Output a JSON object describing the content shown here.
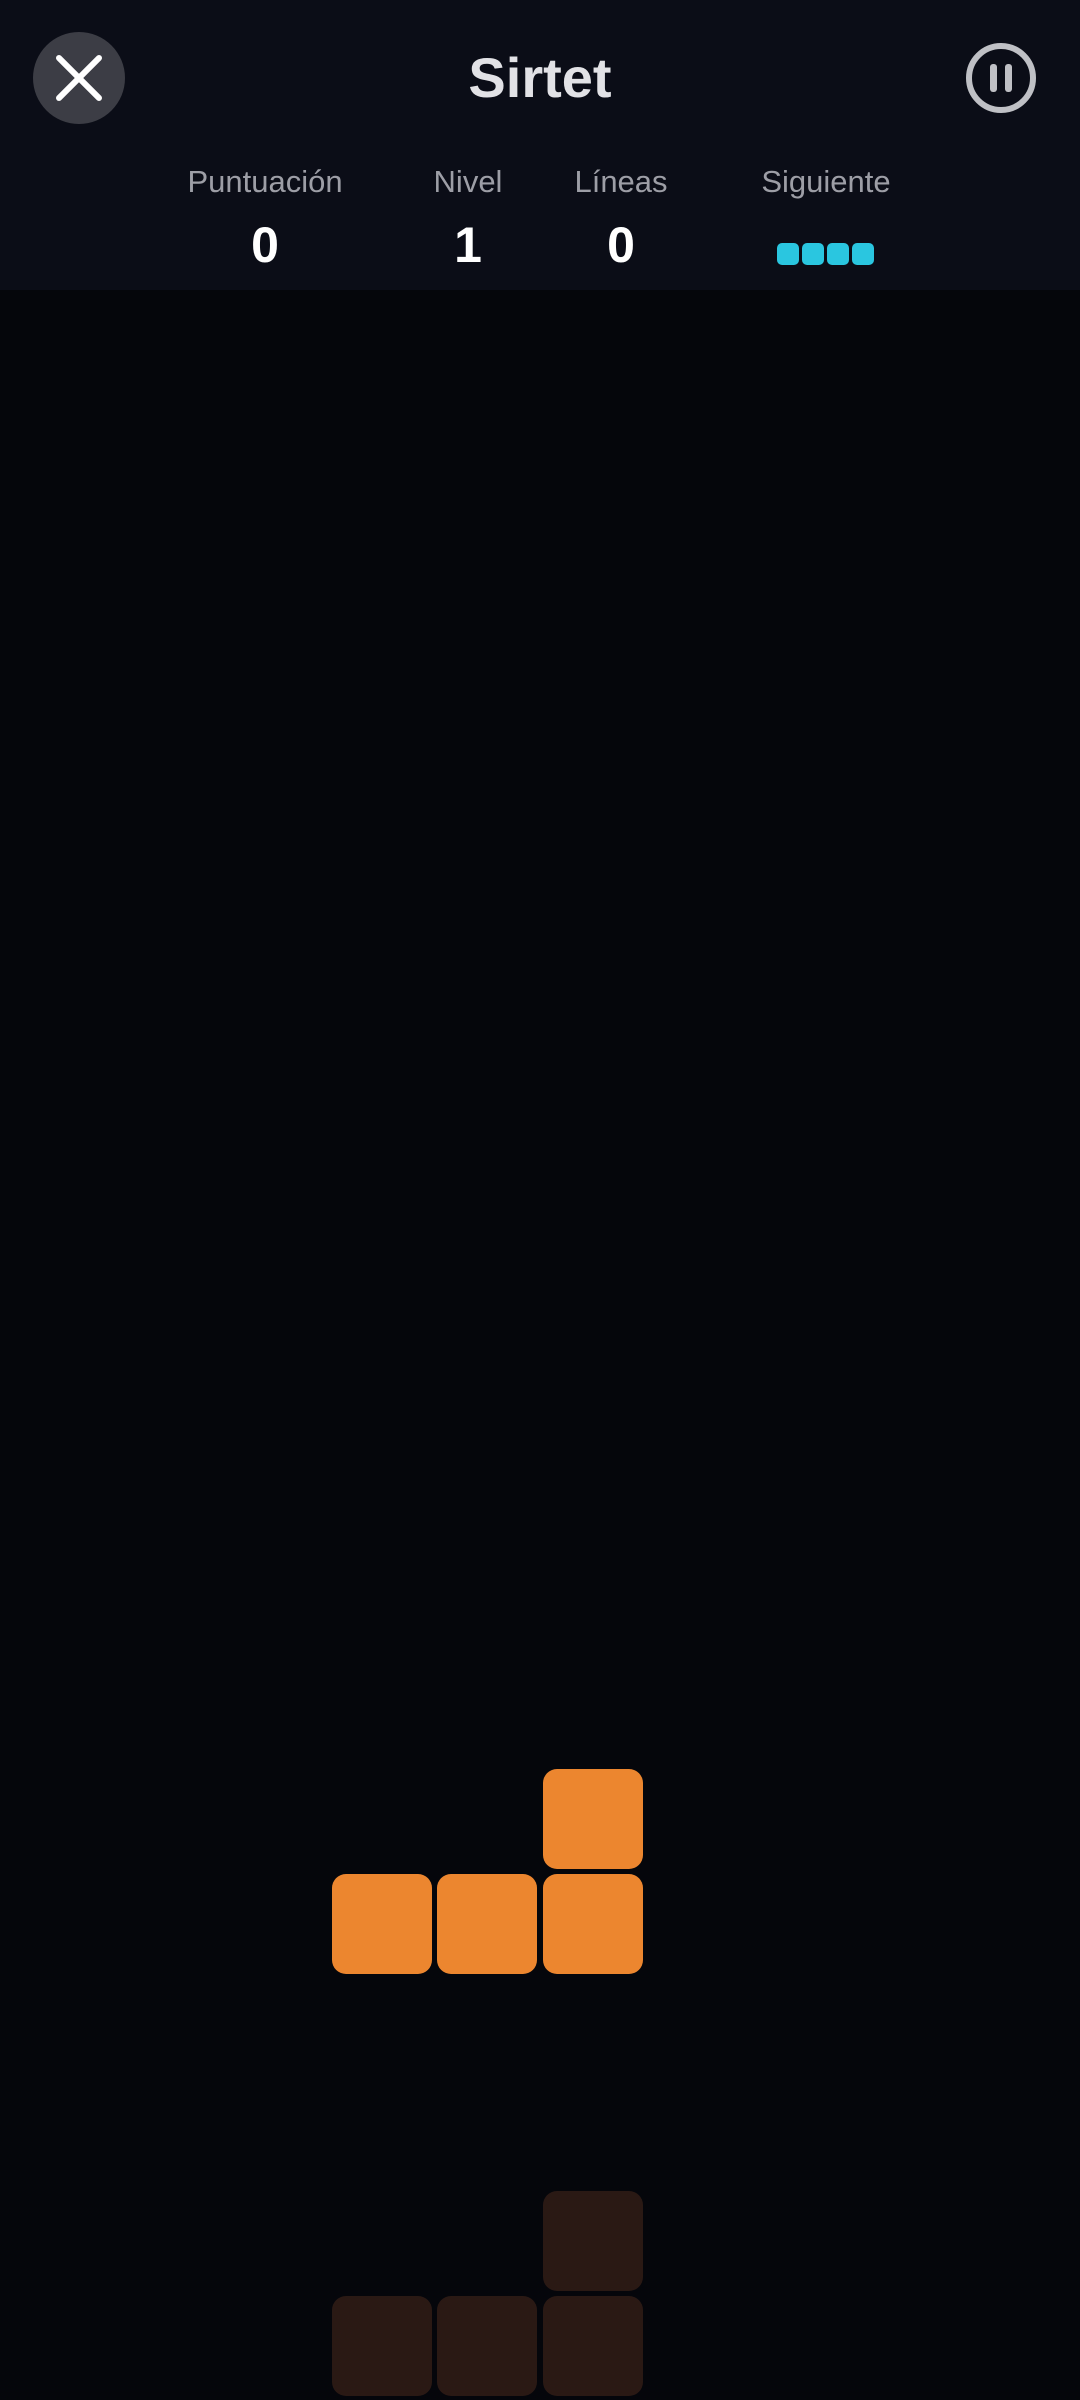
{
  "header": {
    "title": "Sirtet",
    "close_icon": "close-icon",
    "pause_icon": "pause-icon"
  },
  "stats": {
    "score": {
      "label": "Puntuación",
      "value": "0"
    },
    "level": {
      "label": "Nivel",
      "value": "1"
    },
    "lines": {
      "label": "Líneas",
      "value": "0"
    },
    "next": {
      "label": "Siguiente",
      "piece": "I",
      "color": "#2ac6e0"
    }
  },
  "board": {
    "active_piece": {
      "type": "L",
      "color": "#ec862f"
    },
    "ghost_piece": {
      "type": "L",
      "color": "#2a1914"
    }
  }
}
